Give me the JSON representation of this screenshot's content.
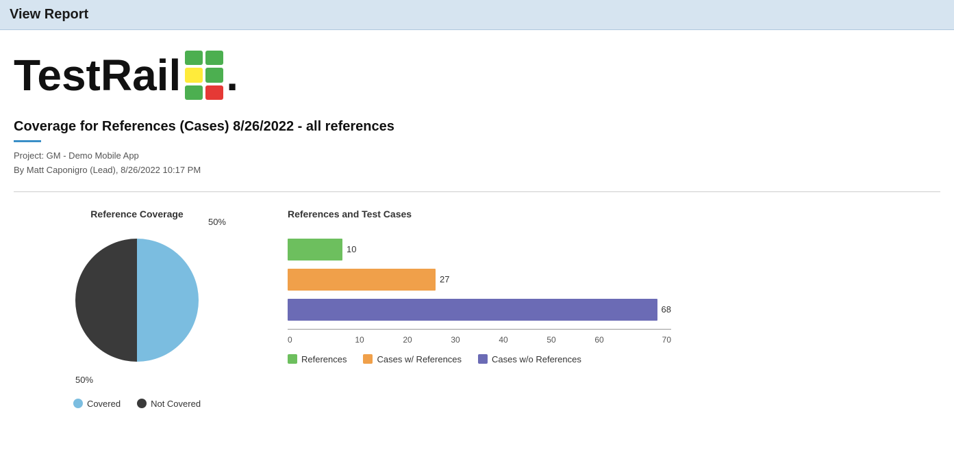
{
  "header": {
    "title": "View Report"
  },
  "logo": {
    "text": "TestRail",
    "dot": ".",
    "grid_colors": [
      "#4caf50",
      "#4caf50",
      "#ffeb3b",
      "#4caf50",
      "#4caf50",
      "#e53935"
    ]
  },
  "report": {
    "title": "Coverage for References (Cases) 8/26/2022 - all references",
    "project": "Project: GM - Demo Mobile App",
    "author": "By Matt Caponigro (Lead), 8/26/2022 10:17 PM"
  },
  "pie_chart": {
    "title": "Reference Coverage",
    "covered_pct": 50,
    "not_covered_pct": 50,
    "covered_label": "50%",
    "not_covered_label": "50%",
    "covered_color": "#7bbde0",
    "not_covered_color": "#3a3a3a",
    "legend": [
      {
        "label": "Covered",
        "color": "#7bbde0"
      },
      {
        "label": "Not Covered",
        "color": "#3a3a3a"
      }
    ]
  },
  "bar_chart": {
    "title": "References and Test Cases",
    "bars": [
      {
        "label": "References",
        "value": 10,
        "color": "#6dbf5e",
        "max": 70
      },
      {
        "label": "Cases w/ References",
        "value": 27,
        "color": "#f0a04a",
        "max": 70
      },
      {
        "label": "Cases w/o References",
        "value": 68,
        "color": "#6b6bb5",
        "max": 70
      }
    ],
    "x_ticks": [
      "0",
      "10",
      "20",
      "30",
      "40",
      "50",
      "60",
      "70"
    ],
    "legend": [
      {
        "label": "References",
        "color": "#6dbf5e"
      },
      {
        "label": "Cases w/ References",
        "color": "#f0a04a"
      },
      {
        "label": "Cases w/o References",
        "color": "#6b6bb5"
      }
    ]
  }
}
